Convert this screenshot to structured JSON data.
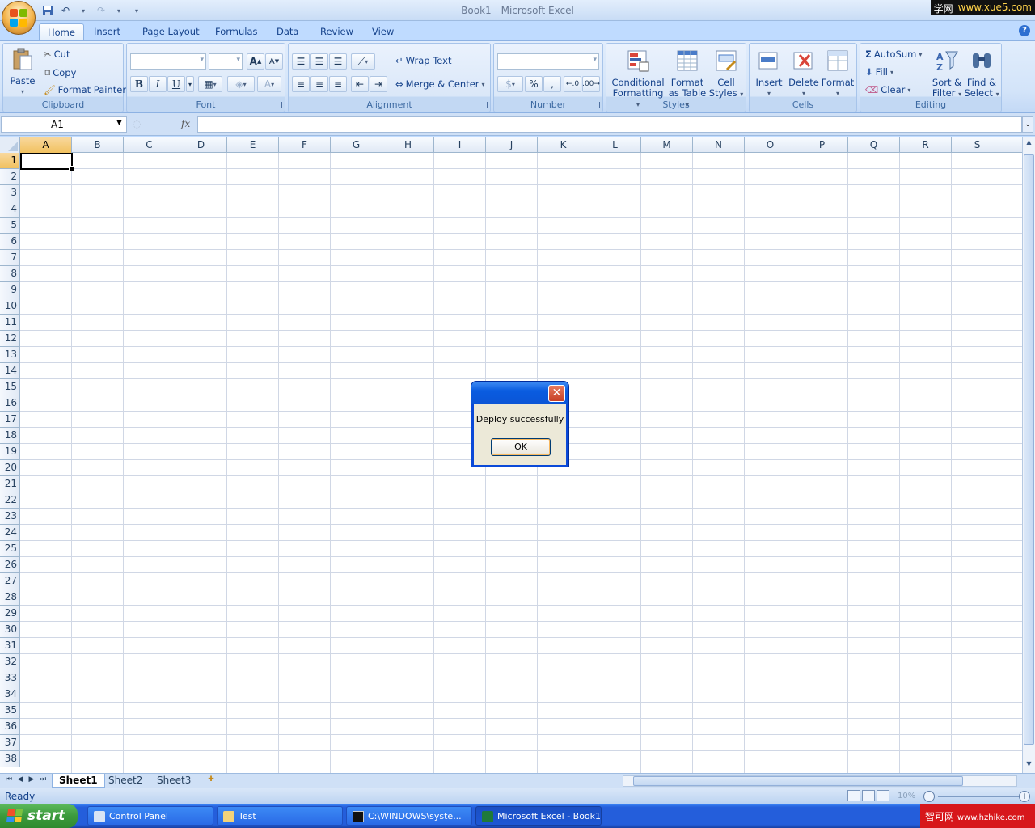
{
  "window": {
    "title": "Book1 - Microsoft Excel",
    "watermark_top_a": "学网",
    "watermark_top_b": "www.xue5.com"
  },
  "tabs": [
    {
      "label": "Home",
      "active": true
    },
    {
      "label": "Insert"
    },
    {
      "label": "Page Layout"
    },
    {
      "label": "Formulas"
    },
    {
      "label": "Data"
    },
    {
      "label": "Review"
    },
    {
      "label": "View"
    }
  ],
  "ribbon": {
    "clipboard": {
      "label": "Clipboard",
      "paste": "Paste",
      "cut": "Cut",
      "copy": "Copy",
      "format_painter": "Format Painter"
    },
    "font": {
      "label": "Font",
      "bold": "B",
      "italic": "I",
      "underline": "U"
    },
    "alignment": {
      "label": "Alignment",
      "wrap_text": "Wrap Text",
      "merge_center": "Merge & Center"
    },
    "number": {
      "label": "Number",
      "currency": "$",
      "percent": "%",
      "comma": ","
    },
    "styles": {
      "label": "Styles",
      "conditional_1": "Conditional",
      "conditional_2": "Formatting",
      "table_1": "Format",
      "table_2": "as Table",
      "cell_1": "Cell",
      "cell_2": "Styles"
    },
    "cells": {
      "label": "Cells",
      "insert": "Insert",
      "delete": "Delete",
      "format": "Format"
    },
    "editing": {
      "label": "Editing",
      "autosum": "AutoSum",
      "fill": "Fill",
      "clear": "Clear",
      "sort_1": "Sort &",
      "sort_2": "Filter",
      "find_1": "Find &",
      "find_2": "Select"
    }
  },
  "formula_bar": {
    "name_box": "A1",
    "fx": "fx",
    "formula": ""
  },
  "grid": {
    "columns": [
      "A",
      "B",
      "C",
      "D",
      "E",
      "F",
      "G",
      "H",
      "I",
      "J",
      "K",
      "L",
      "M",
      "N",
      "O",
      "P",
      "Q",
      "R",
      "S"
    ],
    "rows": [
      "1",
      "2",
      "3",
      "4",
      "5",
      "6",
      "7",
      "8",
      "9",
      "10",
      "11",
      "12",
      "13",
      "14",
      "15",
      "16",
      "17",
      "18",
      "19",
      "20",
      "21",
      "22",
      "23",
      "24",
      "25",
      "26",
      "27",
      "28",
      "29",
      "30",
      "31",
      "32",
      "33",
      "34",
      "35",
      "36",
      "37",
      "38"
    ],
    "selected_cell": "A1"
  },
  "sheets": [
    {
      "label": "Sheet1",
      "active": true
    },
    {
      "label": "Sheet2"
    },
    {
      "label": "Sheet3"
    }
  ],
  "status": {
    "text": "Ready",
    "zoom": "10%"
  },
  "dialog": {
    "message": "Deploy successfully",
    "ok": "OK",
    "close": "✕"
  },
  "taskbar": {
    "start": "start",
    "items": [
      {
        "label": "Control Panel"
      },
      {
        "label": "Test"
      },
      {
        "label": "C:\\WINDOWS\\syste..."
      },
      {
        "label": "Microsoft Excel - Book1",
        "active": true
      }
    ],
    "watermark_a": "智可网",
    "watermark_b": "www.hzhike.com"
  },
  "colors": {
    "accent": "#15428b",
    "ribbon": "#dae7f8",
    "selection": "#f1c15f",
    "taskbar": "#245edb",
    "dialog_title": "#0a5ce0"
  }
}
